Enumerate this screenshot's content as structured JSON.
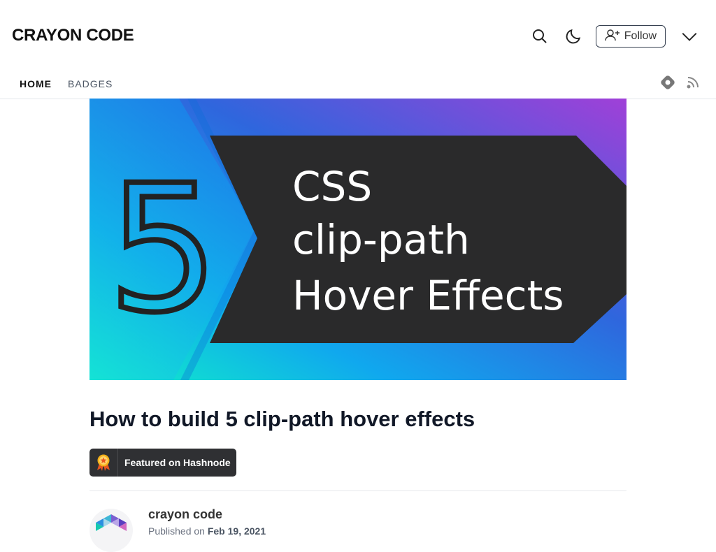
{
  "header": {
    "brand": "CRAYON CODE",
    "follow_label": "Follow"
  },
  "nav": {
    "items": [
      {
        "label": "HOME",
        "active": true
      },
      {
        "label": "BADGES",
        "active": false
      }
    ]
  },
  "cover": {
    "number": "5",
    "line1": "CSS",
    "line2": "clip-path",
    "line3": "Hover Effects",
    "colors": {
      "cyan": "#13e0d4",
      "blue": "#1e88e5",
      "purple": "#9b3fd6",
      "band": "#2a2a2b"
    }
  },
  "article": {
    "title": "How to build 5 clip-path hover effects",
    "featured_label": "Featured on Hashnode",
    "author_name": "crayon code",
    "published_prefix": "Published on",
    "published_date": "Feb 19, 2021"
  }
}
